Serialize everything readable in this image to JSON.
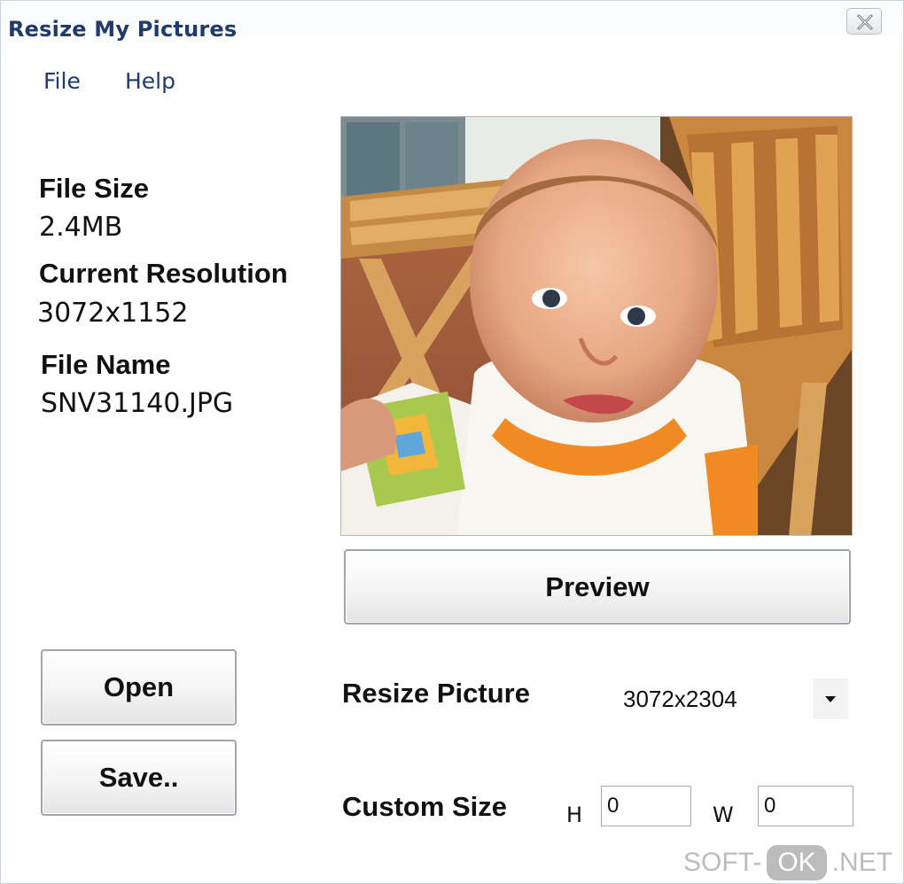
{
  "window": {
    "title": "Resize My Pictures"
  },
  "menu": {
    "items": [
      "File",
      "Help"
    ]
  },
  "info": {
    "file_size_label": "File Size",
    "file_size_value": "2.4MB",
    "resolution_label": "Current Resolution",
    "resolution_value": "3072x1152",
    "file_name_label": "File Name",
    "file_name_value": "SNV31140.JPG"
  },
  "buttons": {
    "preview": "Preview",
    "open": "Open",
    "save": "Save.."
  },
  "resize": {
    "label": "Resize Picture",
    "selected": "3072x2304"
  },
  "custom": {
    "label": "Custom Size",
    "h_label": "H",
    "h_value": "0",
    "w_label": "W",
    "w_value": "0"
  },
  "watermark": {
    "left": "SOFT-",
    "badge": "OK",
    "right": ".NET"
  },
  "icons": {
    "close": "close-icon",
    "dropdown": "chevron-down-icon"
  },
  "colors": {
    "title_text": "#1f3a6b",
    "button_border": "#9fa6ad"
  }
}
